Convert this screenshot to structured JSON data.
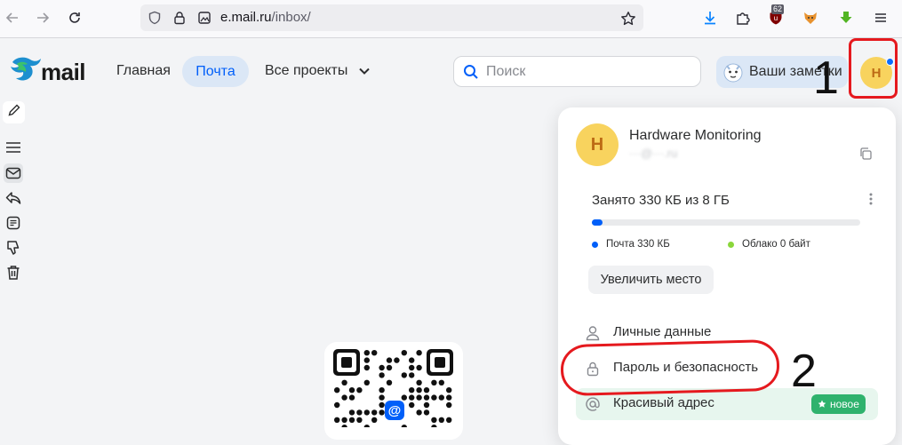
{
  "browser": {
    "url_host": "e.mail.ru",
    "url_path": "/inbox/",
    "extension_badge": "62"
  },
  "header": {
    "logo_text": "mail",
    "nav": {
      "home": "Главная",
      "mail": "Почта",
      "projects": "Все проекты"
    },
    "search_placeholder": "Поиск",
    "notes_label": "Ваши заметки",
    "avatar_letter": "H"
  },
  "dropdown": {
    "avatar_letter": "H",
    "name": "Hardware Monitoring",
    "email": "···@···.ru",
    "storage": {
      "title": "Занято 330 КБ из 8 ГБ",
      "used_fraction": 0.04,
      "legend": [
        {
          "label": "Почта 330 КБ",
          "color": "#005ff9"
        },
        {
          "label": "Облако 0 байт",
          "color": "#8ad63b"
        }
      ],
      "button": "Увеличить место"
    },
    "menu": [
      {
        "label": "Личные данные",
        "icon": "person-icon"
      },
      {
        "label": "Пароль и безопасность",
        "icon": "lock-icon"
      },
      {
        "label": "Красивый адрес",
        "icon": "at-icon",
        "badge": "новое"
      }
    ]
  },
  "annotations": {
    "first": "1",
    "second": "2"
  },
  "colors": {
    "accent": "#005ff9",
    "avatar_bg": "#f8d35e",
    "annotation_red": "#e5191e",
    "badge_green": "#2fb26d"
  }
}
